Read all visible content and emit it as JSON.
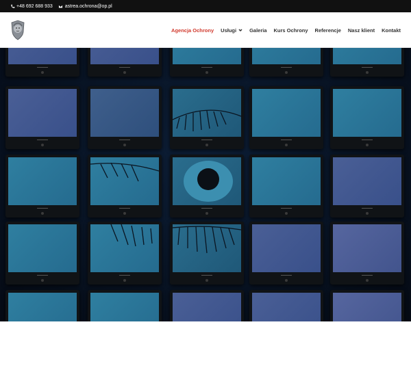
{
  "topbar": {
    "phone": "+48 692 688 933",
    "email": "astrea.ochrona@op.pl",
    "phone_icon": "phone-icon",
    "email_icon": "envelope-icon"
  },
  "header": {
    "logo_icon": "lion-crest-logo",
    "nav": [
      {
        "label": "Agencja Ochrony",
        "active": true
      },
      {
        "label": "Usługi",
        "dropdown": true
      },
      {
        "label": "Galeria"
      },
      {
        "label": "Kurs Ochrony"
      },
      {
        "label": "Referencje"
      },
      {
        "label": "Nasz klient"
      },
      {
        "label": "Kontakt"
      }
    ]
  },
  "colors": {
    "active_nav": "#d13a2e",
    "topbar_bg": "#111111",
    "hero_bg": "#07101e",
    "screen_blue": "#2f6f91"
  },
  "hero": {
    "description_icon": "surveillance-monitor-wall-image"
  }
}
